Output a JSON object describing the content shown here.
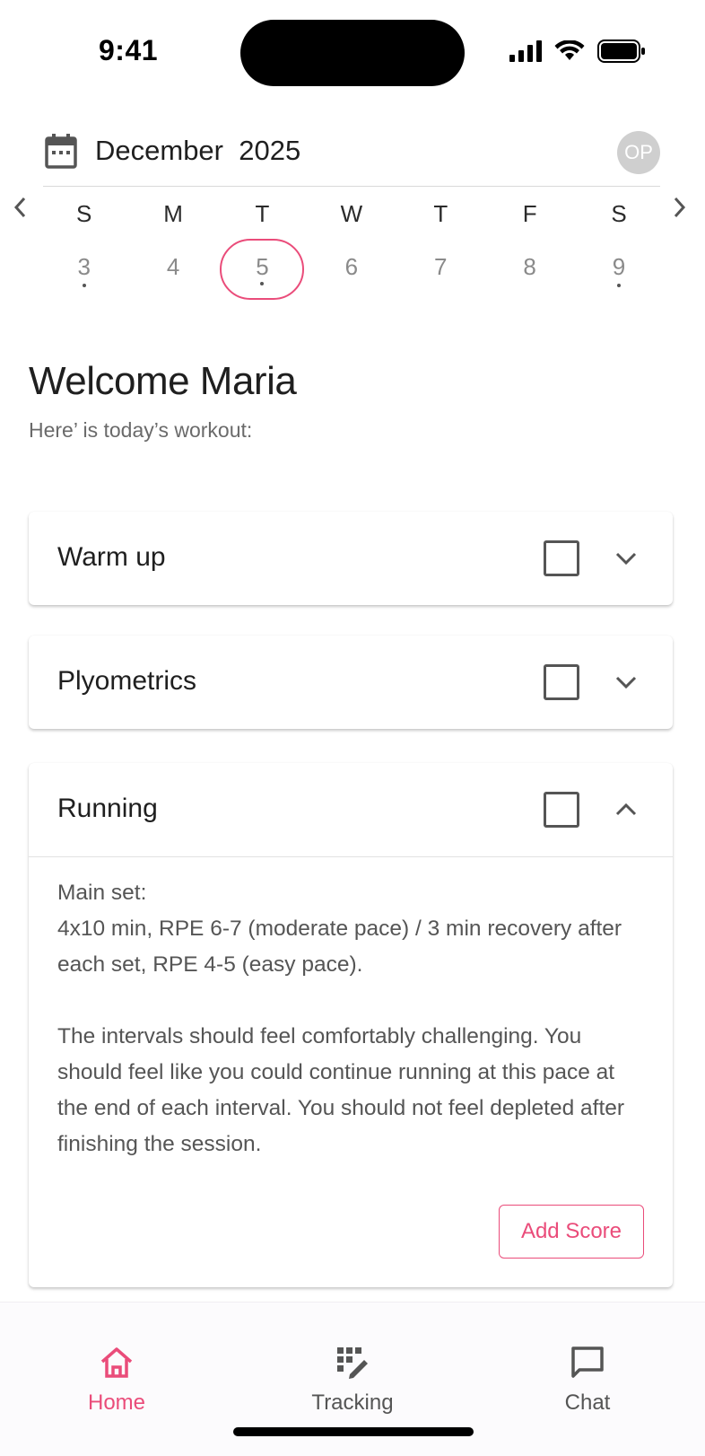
{
  "status_bar": {
    "time": "9:41"
  },
  "header": {
    "month": "December",
    "year": "2025",
    "avatar_initials": "OP"
  },
  "week": {
    "days": [
      {
        "letter": "S",
        "number": "3",
        "has_event": true,
        "selected": false
      },
      {
        "letter": "M",
        "number": "4",
        "has_event": false,
        "selected": false
      },
      {
        "letter": "T",
        "number": "5",
        "has_event": true,
        "selected": true
      },
      {
        "letter": "W",
        "number": "6",
        "has_event": false,
        "selected": false
      },
      {
        "letter": "T",
        "number": "7",
        "has_event": false,
        "selected": false
      },
      {
        "letter": "F",
        "number": "8",
        "has_event": false,
        "selected": false
      },
      {
        "letter": "S",
        "number": "9",
        "has_event": true,
        "selected": false
      }
    ]
  },
  "welcome": {
    "title": "Welcome Maria",
    "subtitle": "Here’ is today’s workout:"
  },
  "workouts": [
    {
      "title": "Warm up",
      "checked": false,
      "expanded": false
    },
    {
      "title": "Plyometrics",
      "checked": false,
      "expanded": false
    },
    {
      "title": "Running",
      "checked": false,
      "expanded": true,
      "body_paragraph_1": "Main set:\n4x10 min, RPE 6-7 (moderate pace) / 3 min recovery after each set, RPE 4-5 (easy pace).",
      "body_paragraph_2": "The intervals should feel comfortably challenging. You should feel like you could continue running at this pace at the end of each interval. You should not feel depleted after finishing the session.",
      "action_label": "Add Score"
    }
  ],
  "bottom_nav": {
    "items": [
      {
        "label": "Home",
        "icon": "home-icon",
        "active": true
      },
      {
        "label": "Tracking",
        "icon": "tracking-icon",
        "active": false
      },
      {
        "label": "Chat",
        "icon": "chat-icon",
        "active": false
      }
    ]
  },
  "colors": {
    "accent": "#ea4c7a",
    "text_primary": "#1f1f1f",
    "text_secondary": "#555555",
    "day_number": "#8a8a8a"
  }
}
